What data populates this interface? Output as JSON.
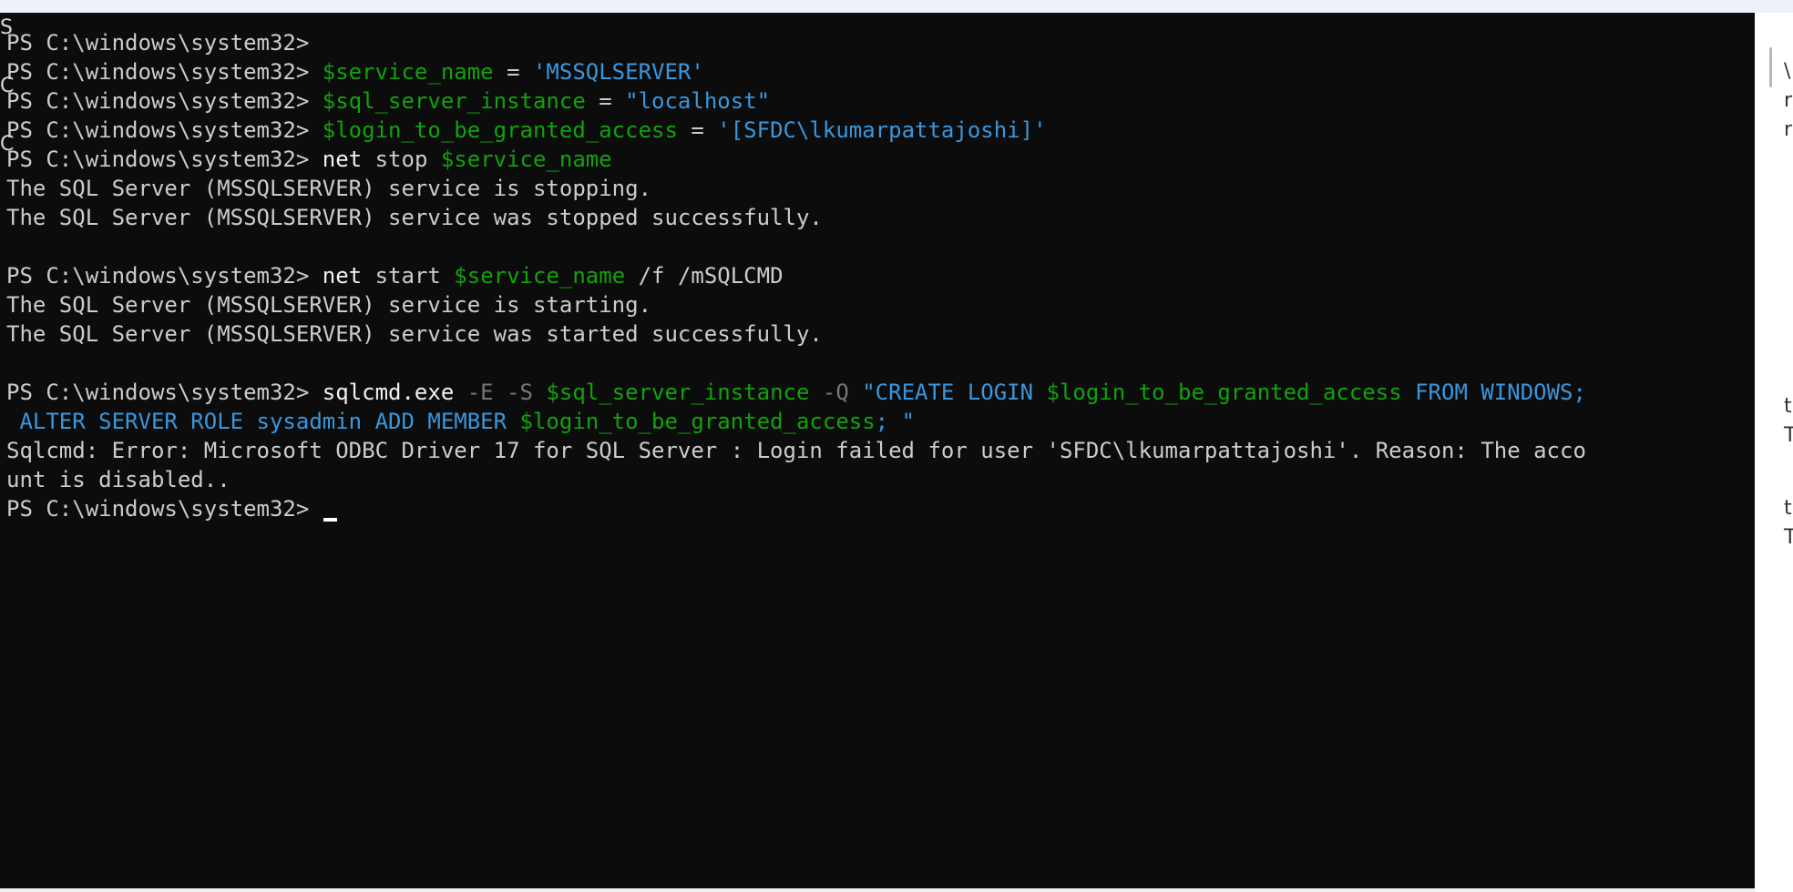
{
  "terminal": {
    "lines": [
      [
        {
          "t": "PS C:\\windows\\system32> ",
          "c": "default"
        }
      ],
      [
        {
          "t": "PS C:\\windows\\system32> ",
          "c": "default"
        },
        {
          "t": "$service_name",
          "c": "var"
        },
        {
          "t": " = ",
          "c": "default"
        },
        {
          "t": "'MSSQLSERVER'",
          "c": "str"
        }
      ],
      [
        {
          "t": "PS C:\\windows\\system32> ",
          "c": "default"
        },
        {
          "t": "$sql_server_instance",
          "c": "var"
        },
        {
          "t": " = ",
          "c": "default"
        },
        {
          "t": "\"localhost\"",
          "c": "str"
        }
      ],
      [
        {
          "t": "PS C:\\windows\\system32> ",
          "c": "default"
        },
        {
          "t": "$login_to_be_granted_access",
          "c": "var"
        },
        {
          "t": " = ",
          "c": "default"
        },
        {
          "t": "'[SFDC\\lkumarpattajoshi]'",
          "c": "str"
        }
      ],
      [
        {
          "t": "PS C:\\windows\\system32> ",
          "c": "default"
        },
        {
          "t": "net",
          "c": "cmd"
        },
        {
          "t": " stop ",
          "c": "default"
        },
        {
          "t": "$service_name",
          "c": "var"
        }
      ],
      [
        {
          "t": "The SQL Server (MSSQLSERVER) service is stopping.",
          "c": "default"
        }
      ],
      [
        {
          "t": "The SQL Server (MSSQLSERVER) service was stopped successfully.",
          "c": "default"
        }
      ],
      [
        {
          "t": "",
          "c": "default"
        }
      ],
      [
        {
          "t": "PS C:\\windows\\system32> ",
          "c": "default"
        },
        {
          "t": "net",
          "c": "cmd"
        },
        {
          "t": " start ",
          "c": "default"
        },
        {
          "t": "$service_name",
          "c": "var"
        },
        {
          "t": " /f /mSQLCMD",
          "c": "default"
        }
      ],
      [
        {
          "t": "The SQL Server (MSSQLSERVER) service is starting.",
          "c": "default"
        }
      ],
      [
        {
          "t": "The SQL Server (MSSQLSERVER) service was started successfully.",
          "c": "default"
        }
      ],
      [
        {
          "t": "",
          "c": "default"
        }
      ],
      [
        {
          "t": "PS C:\\windows\\system32> ",
          "c": "default"
        },
        {
          "t": "sqlcmd.exe",
          "c": "cmd"
        },
        {
          "t": " -E -S ",
          "c": "param"
        },
        {
          "t": "$sql_server_instance",
          "c": "var"
        },
        {
          "t": " -Q ",
          "c": "param"
        },
        {
          "t": "\"CREATE LOGIN ",
          "c": "str"
        },
        {
          "t": "$login_to_be_granted_access",
          "c": "var"
        },
        {
          "t": " FROM WINDOWS;",
          "c": "str"
        }
      ],
      [
        {
          "t": " ALTER SERVER ROLE sysadmin ADD MEMBER ",
          "c": "str"
        },
        {
          "t": "$login_to_be_granted_access",
          "c": "var"
        },
        {
          "t": "; \"",
          "c": "str"
        }
      ],
      [
        {
          "t": "Sqlcmd: Error: Microsoft ODBC Driver 17 for SQL Server : Login failed for user 'SFDC\\lkumarpattajoshi'. Reason: The acco",
          "c": "default"
        }
      ],
      [
        {
          "t": "unt is disabled..",
          "c": "default"
        }
      ],
      [
        {
          "t": "PS C:\\windows\\system32> ",
          "c": "default"
        }
      ]
    ],
    "colors": {
      "background": "#0c0c0c",
      "default": "#cccccc",
      "var": "#13a10e",
      "str": "#3a96dd",
      "param": "#767676",
      "cmd": "#f2f2f2"
    }
  },
  "right_edge_chars": [
    "\\",
    "r",
    "r",
    "",
    "",
    "",
    "",
    "",
    "",
    "t",
    "T",
    "",
    "t",
    "T"
  ],
  "left_edge_chars": [
    "S",
    "",
    "C",
    "",
    "C",
    "",
    ""
  ]
}
